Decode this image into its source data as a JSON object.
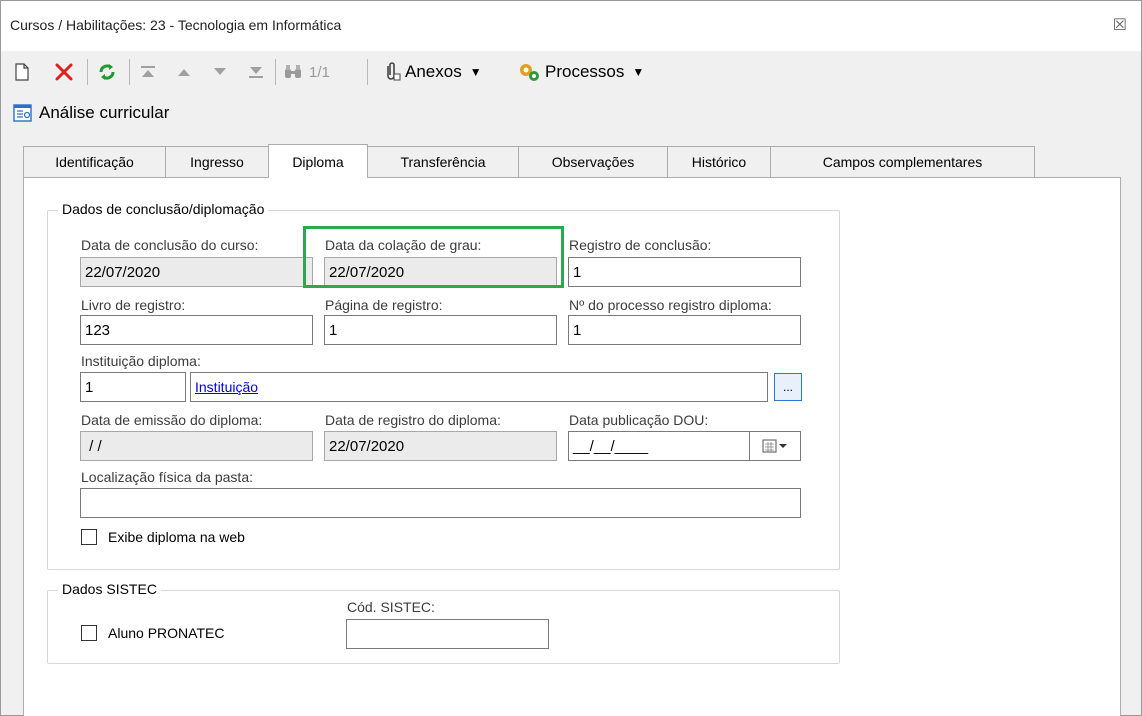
{
  "window": {
    "title": "Cursos / Habilitações: 23 - Tecnologia em Informática",
    "close_glyph": "☒"
  },
  "toolbar": {
    "pager": "1/1",
    "attachments_label": "Anexos",
    "processes_label": "Processos"
  },
  "analysis_link": "Análise curricular",
  "tabs": [
    {
      "label": "Identificação",
      "active": false
    },
    {
      "label": "Ingresso",
      "active": false
    },
    {
      "label": "Diploma",
      "active": true
    },
    {
      "label": "Transferência",
      "active": false
    },
    {
      "label": "Observações",
      "active": false
    },
    {
      "label": "Histórico",
      "active": false
    },
    {
      "label": "Campos complementares",
      "active": false
    }
  ],
  "conclusion_group": {
    "legend": "Dados de conclusão/diplomação",
    "course_conclusion_date": {
      "label": "Data de conclusão do curso:",
      "value": "22/07/2020"
    },
    "graduation_date": {
      "label": "Data da colação de grau:",
      "value": "22/07/2020"
    },
    "conclusion_record": {
      "label": "Registro de conclusão:",
      "value": "1"
    },
    "register_book": {
      "label": "Livro de registro:",
      "value": "123"
    },
    "register_page": {
      "label": "Página de registro:",
      "value": "1"
    },
    "diploma_process_number": {
      "label": "Nº do processo registro diploma:",
      "value": "1"
    },
    "diploma_institution": {
      "label": "Instituição diploma:",
      "code": "1",
      "name": "Instituição",
      "lookup_label": "..."
    },
    "diploma_issue_date": {
      "label": "Data de emissão do diploma:",
      "value": " / /"
    },
    "diploma_register_date": {
      "label": "Data de registro do diploma:",
      "value": "22/07/2020"
    },
    "dou_publication_date": {
      "label": "Data publicação DOU:",
      "value": "__/__/____"
    },
    "folder_location": {
      "label": "Localização física da pasta:",
      "value": ""
    },
    "show_diploma_web": {
      "label": "Exibe diploma na web",
      "checked": false
    }
  },
  "sistec_group": {
    "legend": "Dados SISTEC",
    "pronatec": {
      "label": "Aluno PRONATEC",
      "checked": false
    },
    "sistec_code": {
      "label": "Cód. SISTEC:",
      "value": ""
    }
  },
  "colors": {
    "highlight": "#2ea84f",
    "link": "#0000e0",
    "delete": "#e01e1e",
    "refresh": "#1f9a2f"
  }
}
